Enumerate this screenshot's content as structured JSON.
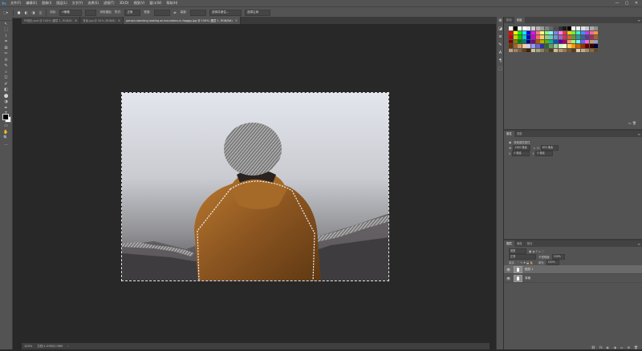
{
  "app": {
    "logo": "Ps"
  },
  "menu": [
    "文件(F)",
    "编辑(E)",
    "图像(I)",
    "图层(L)",
    "文字(Y)",
    "选择(S)",
    "滤镜(T)",
    "3D(D)",
    "视图(V)",
    "窗口(W)",
    "帮助(H)"
  ],
  "window_controls": [
    "—",
    "▢",
    "✕"
  ],
  "options": {
    "feather_label": "羽化:",
    "feather_value": "0像素",
    "antialias_label": "消除锯齿",
    "style_label": "样式:",
    "style_value": "正常",
    "width_label": "宽度:",
    "height_label": "高度:",
    "select_subject": "选择并遮住...",
    "refine": "选择主体"
  },
  "tabs": [
    {
      "label": "PS图片.psd @ 100% (图层 1, RGB/8)",
      "active": false
    },
    {
      "label": "背景.jpg @ 50% (RGB/8)",
      "active": false
    },
    {
      "label": "person-standing-looking-at-mountains-in-fogggy.jpg @ 100% (图层 1, RGB/8#)",
      "active": true
    }
  ],
  "tools": [
    "↖",
    "⬚",
    "⌇",
    "⌗",
    "⊞",
    "✂",
    "⊙",
    "✎",
    "⬨",
    "⎋",
    "✐",
    "◧",
    "⬤",
    "◑",
    "✒",
    "T",
    "↖",
    "▭",
    "✋",
    "🔍",
    "…"
  ],
  "status": {
    "zoom": "100%",
    "doc": "文档:1.03M/2.06M",
    "arrow": "›"
  },
  "side_icons": [
    "⚙",
    "◪",
    "≡",
    "✎",
    "A",
    "¶",
    "⬚"
  ],
  "swatches": {
    "tabs": [
      "颜色",
      "色板"
    ],
    "rows": [
      [
        "#ffffff",
        "#000000",
        "#ffffff",
        "#ffffff",
        "#e6e6e6",
        "#cccccc",
        "#b3b3b3",
        "#999999",
        "#808080",
        "#666666",
        "#4d4d4d",
        "#333333",
        "#1a1a1a",
        "#000000",
        "#ffffff",
        "#f2f2f2",
        "#e0e0e0",
        "#c7c7c7",
        "#aaaaaa",
        "#8e8e8e"
      ],
      [
        "#ff0000",
        "#ffff00",
        "#00ff00",
        "#00ffff",
        "#0000ff",
        "#ff00ff",
        "#ff8080",
        "#ffff80",
        "#80ff80",
        "#80ffff",
        "#8080ff",
        "#ff80ff",
        "#ff3333",
        "#ffcc00",
        "#66ff33",
        "#33ffcc",
        "#3399ff",
        "#cc33ff",
        "#ff6699",
        "#ff9933"
      ],
      [
        "#cc0000",
        "#cccc00",
        "#00cc00",
        "#00cccc",
        "#0000cc",
        "#cc00cc",
        "#ff6666",
        "#ffcc66",
        "#99cc66",
        "#66cccc",
        "#6699cc",
        "#9966cc",
        "#cc3366",
        "#cc6633",
        "#669933",
        "#339999",
        "#336699",
        "#663399",
        "#993366",
        "#996633"
      ],
      [
        "#800000",
        "#808000",
        "#008000",
        "#008080",
        "#000080",
        "#800080",
        "#b35900",
        "#b3b300",
        "#59b300",
        "#00b3b3",
        "#0059b3",
        "#5900b3",
        "#b30059",
        "#ff9966",
        "#99ff66",
        "#66ffff",
        "#6666ff",
        "#ff66cc",
        "#cc9966",
        "#9999cc"
      ],
      [
        "#663300",
        "#996633",
        "#cc9966",
        "#ffcc99",
        "#ccccff",
        "#9999ff",
        "#6666cc",
        "#333399",
        "#336633",
        "#669966",
        "#99cc99",
        "#ccffcc",
        "#ffffcc",
        "#ffcc66",
        "#ff9900",
        "#cc6600",
        "#993300",
        "#660000",
        "#330000",
        "#000033"
      ],
      [
        "#c0a080",
        "#a08060",
        "#806040",
        "#604020",
        "#402000",
        "#c8c0a0",
        "#a8a080",
        "#888060",
        "#686040",
        "#484020",
        "#d8b890",
        "#b89870",
        "#987850",
        "#785830",
        "#584010",
        "#e8c8a0",
        "#c8a880",
        "#a88860",
        "#886840",
        "#684820"
      ]
    ],
    "footer_icons": [
      "▭",
      "🗑"
    ]
  },
  "properties": {
    "tabs": [
      "属性",
      "调整"
    ],
    "title": "像素图层属性",
    "w_label": "W",
    "w_value": "1280 像素",
    "h_label": "H",
    "h_value": "853 像素",
    "x_label": "X",
    "x_value": "0 像素",
    "y_label": "Y",
    "y_value": "0 像素"
  },
  "layers": {
    "tabs": [
      "图层",
      "通道",
      "路径"
    ],
    "kind": "类型",
    "mode": "正常",
    "opacity_label": "不透明度:",
    "opacity_value": "100%",
    "lock_label": "锁定:",
    "fill_label": "填充:",
    "fill_value": "100%",
    "items": [
      {
        "name": "图层 1",
        "selected": true
      },
      {
        "name": "背景",
        "selected": false
      }
    ],
    "footer_icons": [
      "⛓",
      "fx",
      "◐",
      "◑",
      "▭",
      "⊞",
      "🗑"
    ]
  }
}
